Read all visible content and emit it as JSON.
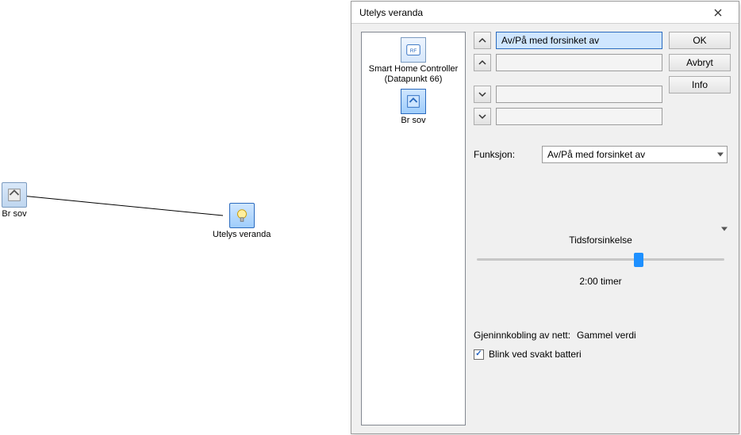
{
  "canvas": {
    "node_switch": {
      "label": "Br sov"
    },
    "node_light": {
      "label": "Utelys veranda"
    }
  },
  "dialog": {
    "title": "Utelys veranda",
    "buttons": {
      "ok": "OK",
      "cancel": "Avbryt",
      "info": "Info"
    },
    "tree": {
      "controller": {
        "line1": "Smart Home Controller",
        "line2": "(Datapunkt 66)"
      },
      "switch": {
        "label": "Br sov"
      }
    },
    "slots": {
      "s1": "Av/På med forsinket av",
      "s2": "",
      "s3": "",
      "s4": ""
    },
    "function_label": "Funksjon:",
    "function_value": "Av/På med forsinket av",
    "delay_label": "Tidsforsinkelse",
    "delay_value": "2:00 timer",
    "delay_pos_pct": 65,
    "reconnect_label": "Gjeninnkobling av nett:",
    "reconnect_value": "Gammel verdi",
    "blink_label": "Blink ved svakt batteri",
    "blink_checked": true
  }
}
